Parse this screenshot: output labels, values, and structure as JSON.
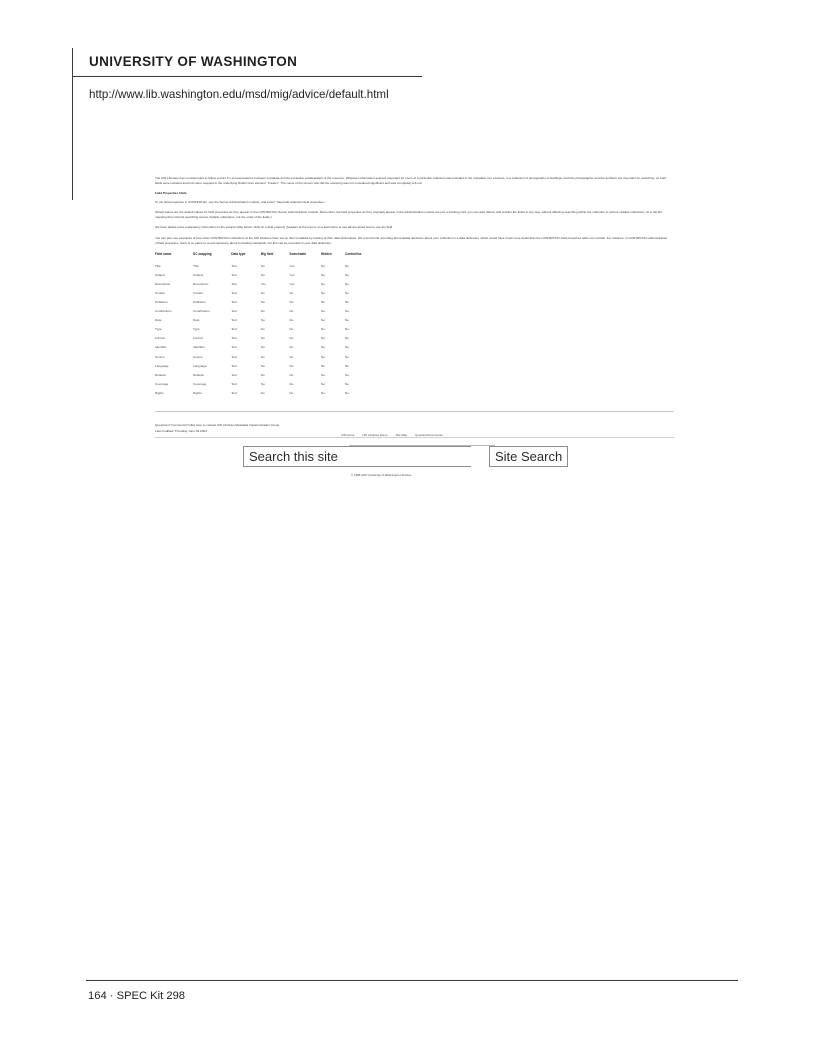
{
  "page": {
    "institution": "UNIVERSITY OF WASHINGTON",
    "url": "http://www.lib.washington.edu/msd/mig/advice/default.html",
    "folio": "164 · SPEC Kit 298"
  },
  "capture": {
    "paragraphs": [
      {
        "style": "body",
        "text": "The UW Libraries has not attempted to follow a strict 1:1 correspondence between metadata and the particular manifestation of the resource. Whatever information seemed important for users of a particular collection was included in the metadata. For example, in a collection of photographs of buildings, both the photographer and the architect are important for searching, so both fields were included and both were mapped to the underlying Dublin Core element \"Creator\". The name of the person who did the scanning was not considered significant and was completely left out."
      },
      {
        "style": "sub-head",
        "text": "Field Properties Table"
      },
      {
        "style": "body",
        "text": "To set field properties in CONTENTdm, use the Server Administration module, and select \"View/edit collection field properties.\""
      },
      {
        "style": "body",
        "text": "Shown below are the default values for field properties as they appear in the CONTENTdm Server Administration module. Remember, the field properties as they originally appear in the Administration module are just a starting point–you can add, delete, and reorder the fields in any way, without affecting searching within the collection or across multiple collections. (It is the DC mapping that controls searching across multiple collections, not the order of the fields.)"
      },
      {
        "style": "body",
        "text": "We have added extra explanatory information to the sample table below. Click on a field property (headers at the top) or on a field name to see advice about how to use the field."
      },
      {
        "style": "body",
        "text": "You can also see examples of how other CONTENTdm collections at the UW Libraries have set up their metadata by looking at their data dictionaries. We recommend recording all metadata decisions about your collection in a data dictionary, which would have much more detail than the CONTENTdm field properties table can contain. For instance, in CONTENTdm administration of field properties, there is no place to record decisions about formatting standards, but this can be recorded in your data dictionary."
      }
    ],
    "table": {
      "headers": [
        "Field name",
        "DC mapping",
        "Data type",
        "Big field",
        "Searchable",
        "Hidden",
        "ControlVoc"
      ],
      "rows": [
        [
          "Title",
          "Title",
          "Text",
          "No",
          "Yes",
          "No",
          "No"
        ],
        [
          "Subject",
          "Subject",
          "Text",
          "No",
          "Yes",
          "No",
          "No"
        ],
        [
          "Description",
          "Description",
          "Text",
          "Yes",
          "Yes",
          "No",
          "No"
        ],
        [
          "Creator",
          "Creator",
          "Text",
          "No",
          "No",
          "No",
          "No"
        ],
        [
          "Publisher",
          "Publisher",
          "Text",
          "No",
          "No",
          "No",
          "No"
        ],
        [
          "Contributors",
          "Contributors",
          "Text",
          "No",
          "No",
          "No",
          "No"
        ],
        [
          "Date",
          "Date",
          "Text",
          "No",
          "No",
          "No",
          "No"
        ],
        [
          "Type",
          "Type",
          "Text",
          "No",
          "No",
          "No",
          "No"
        ],
        [
          "Format",
          "Format",
          "Text",
          "No",
          "No",
          "No",
          "No"
        ],
        [
          "Identifier",
          "Identifier",
          "Text",
          "No",
          "No",
          "No",
          "No"
        ],
        [
          "Source",
          "Source",
          "Text",
          "No",
          "No",
          "No",
          "No"
        ],
        [
          "Language",
          "Language",
          "Text",
          "No",
          "No",
          "No",
          "No"
        ],
        [
          "Relation",
          "Relation",
          "Text",
          "No",
          "No",
          "No",
          "No"
        ],
        [
          "Coverage",
          "Coverage",
          "Text",
          "No",
          "No",
          "No",
          "No"
        ],
        [
          "Rights",
          "Rights",
          "Text",
          "No",
          "No",
          "No",
          "No"
        ]
      ]
    },
    "footer": {
      "contact_line": "Questions? Comments? Click here to contact UW Libraries Metadata Implementation Group",
      "last_modified": "Last modified: Thursday June 03 2004",
      "nav_links": [
        "UW Home",
        "UW Libraries Home",
        "Site Map",
        "Questions/Comments"
      ],
      "search_value": "Search this site",
      "search_button": "Site Search",
      "copyright": "© 1998-2007 University of Washington Libraries"
    }
  }
}
